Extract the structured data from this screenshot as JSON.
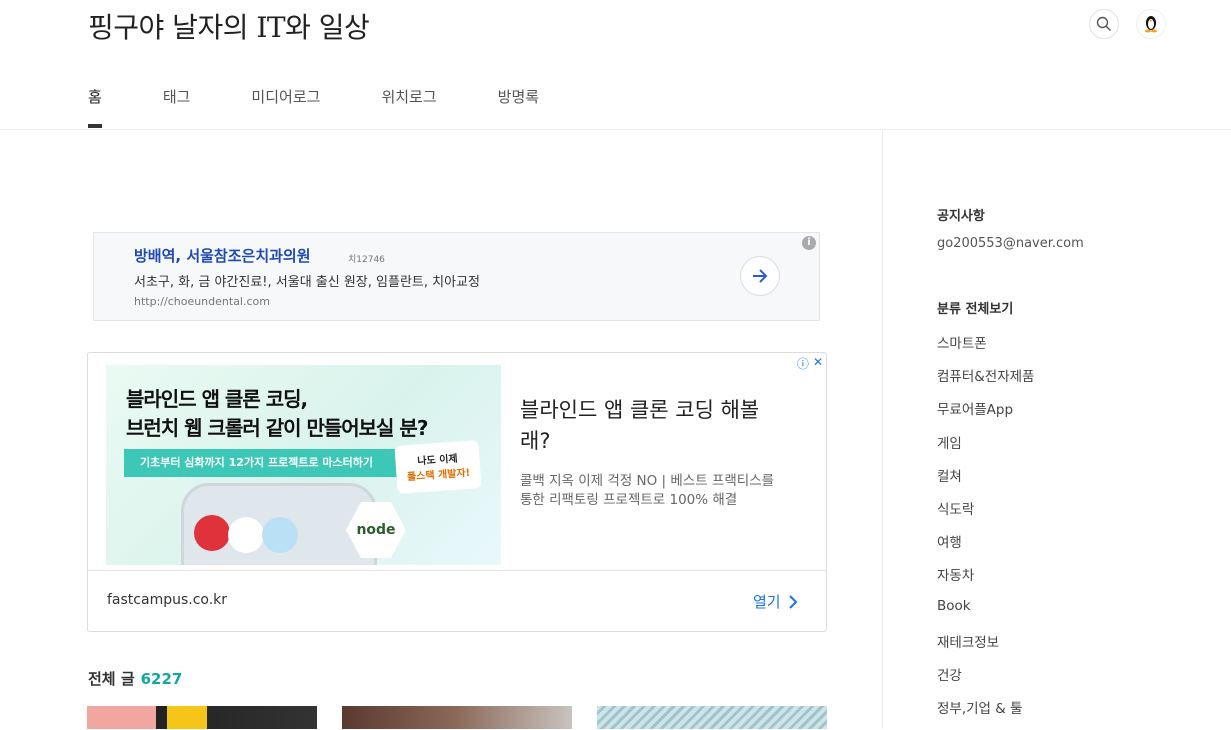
{
  "header": {
    "blog_title": "핑구야 날자의 IT와 일상",
    "search_icon": "search-icon",
    "avatar_icon": "penguin-avatar"
  },
  "nav": {
    "items": [
      {
        "label": "홈",
        "active": true
      },
      {
        "label": "태그",
        "active": false
      },
      {
        "label": "미디어로그",
        "active": false
      },
      {
        "label": "위치로그",
        "active": false
      },
      {
        "label": "방명록",
        "active": false
      }
    ]
  },
  "ad_text": {
    "title": "방배역, 서울참조은치과의원",
    "badge": "치12746",
    "description": "서초구, 화, 금 야간진료!, 서울대 출신 원장, 임플란트, 치아교정",
    "url": "http://choeundental.com",
    "info_icon": "i"
  },
  "ad_display": {
    "image": {
      "line1": "블라인드 앱 클론 코딩,",
      "line2": "브런치 웹 크롤러 같이 만들어보실 분?",
      "pill": "기초부터 심화까지 12가지 프로젝트로 마스터하기",
      "tag_line1": "나도 이제",
      "tag_line2": "풀스택 개발자!",
      "node_label": "node"
    },
    "headline": "블라인드 앱 클론 코딩 해볼래?",
    "description": "콜백 지옥 이제 걱정 NO | 베스트 프랙티스를 통한 리팩토링 프로젝트로 100% 해결",
    "domain": "fastcampus.co.kr",
    "open_label": "열기",
    "adchoices": "ⓘ",
    "close": "✕"
  },
  "posts": {
    "total_label": "전체 글",
    "total_count": "6227"
  },
  "sidebar": {
    "notice_title": "공지사항",
    "notice_email": "go200553@naver.com",
    "category_title": "분류 전체보기",
    "categories": [
      "스마트폰",
      "컴퓨터&전자제품",
      "무료어플App",
      "게임",
      "컬쳐",
      "식도락",
      "여행",
      "자동차",
      "Book",
      "재테크정보",
      "건강",
      "정부,기업 & 툴"
    ]
  }
}
